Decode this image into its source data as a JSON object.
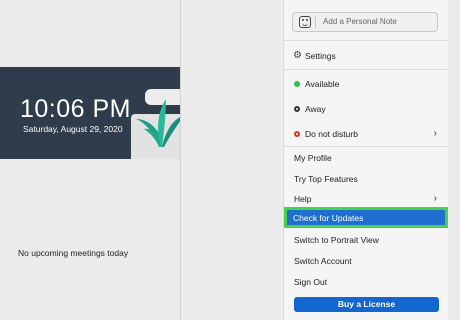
{
  "clock": {
    "time": "10:06 PM",
    "date": "Saturday, August 29, 2020"
  },
  "meetings": {
    "empty_text": "No upcoming meetings today"
  },
  "menu": {
    "note_placeholder": "Add a Personal Note",
    "settings_label": "Settings",
    "status": [
      {
        "label": "Available",
        "color": "#2fbf4a"
      },
      {
        "label": "Away",
        "color": "#ffffff"
      },
      {
        "label": "Do not disturb",
        "color": "#d9372b"
      }
    ],
    "my_profile": "My Profile",
    "try_top_features": "Try Top Features",
    "help": "Help",
    "check_for_updates": "Check for Updates",
    "switch_portrait": "Switch to Portrait View",
    "switch_account": "Switch Account",
    "sign_out": "Sign Out",
    "buy_license": "Buy a License"
  },
  "colors": {
    "highlight_outline": "#46d24d",
    "highlight_fill": "#1f6fd1",
    "button": "#1466cf"
  }
}
